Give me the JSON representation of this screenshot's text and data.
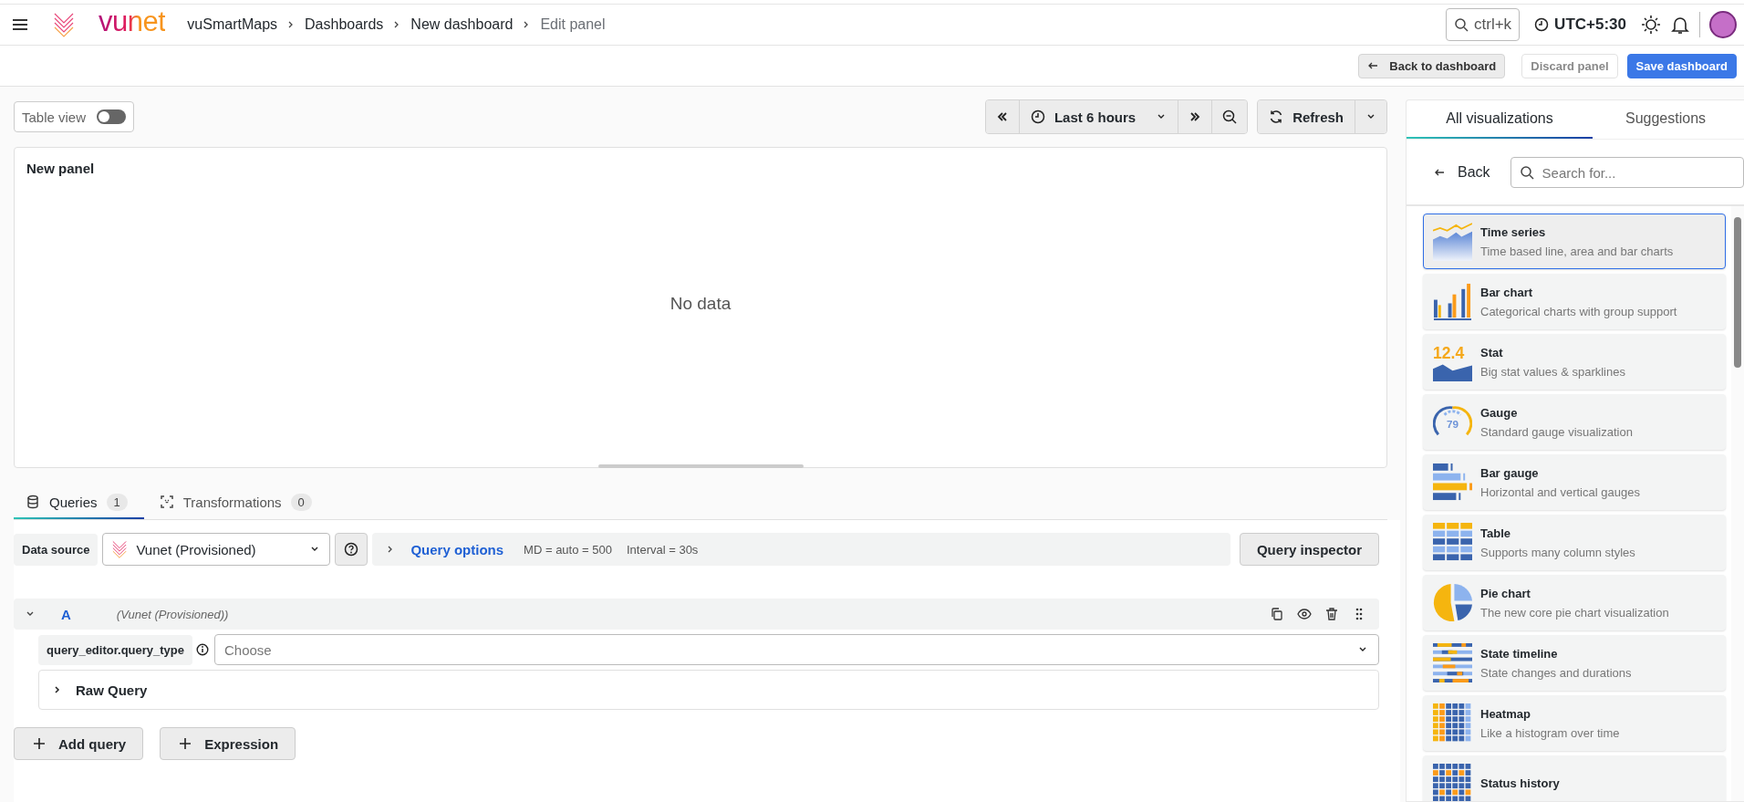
{
  "header": {
    "logo_text": "vunet",
    "breadcrumbs": [
      {
        "label": "vuSmartMaps",
        "current": false
      },
      {
        "label": "Dashboards",
        "current": false
      },
      {
        "label": "New dashboard",
        "current": false
      },
      {
        "label": "Edit panel",
        "current": true
      }
    ],
    "search_shortcut": "ctrl+k",
    "timezone": "UTC+5:30"
  },
  "actions": [
    {
      "label": "Back to dashboard",
      "kind": "back"
    },
    {
      "label": "Discard panel",
      "kind": "outline"
    },
    {
      "label": "Save dashboard",
      "kind": "primary"
    }
  ],
  "table_view": {
    "label": "Table view",
    "on": false
  },
  "time_range": {
    "label": "Last 6 hours"
  },
  "refresh": {
    "label": "Refresh"
  },
  "panel": {
    "title": "New panel",
    "message": "No data"
  },
  "query_tabs": [
    {
      "label": "Queries",
      "count": "1",
      "selected": true,
      "kind": "queries"
    },
    {
      "label": "Transformations",
      "count": "0",
      "selected": false,
      "kind": "transformations"
    }
  ],
  "data_source": {
    "label": "Data source",
    "value": "Vunet (Provisioned)",
    "options_label": "Query options",
    "md": "MD = auto = 500",
    "interval": "Interval = 30s",
    "inspector": "Query inspector"
  },
  "query": {
    "ref": "A",
    "source": "(Vunet (Provisioned))",
    "expanded": true,
    "field_label": "query_editor.query_type",
    "placeholder": "Choose",
    "raw_query": {
      "label": "Raw Query",
      "expanded": false
    }
  },
  "add_buttons": [
    {
      "label": "Add query"
    },
    {
      "label": "Expression"
    }
  ],
  "viz_panel": {
    "tabs": [
      {
        "label": "All visualizations",
        "selected": true
      },
      {
        "label": "Suggestions",
        "selected": false
      }
    ],
    "back": "Back",
    "search_placeholder": "Search for...",
    "items": [
      {
        "kind": "timeseries",
        "title": "Time series",
        "description": "Time based line, area and bar charts",
        "selected": true
      },
      {
        "kind": "barchart",
        "title": "Bar chart",
        "description": "Categorical charts with group support",
        "selected": false
      },
      {
        "kind": "stat",
        "title": "Stat",
        "description": "Big stat values & sparklines",
        "icon_text": "12.4",
        "selected": false
      },
      {
        "kind": "gauge",
        "title": "Gauge",
        "description": "Standard gauge visualization",
        "icon_text": "79",
        "selected": false
      },
      {
        "kind": "bargauge",
        "title": "Bar gauge",
        "description": "Horizontal and vertical gauges",
        "selected": false
      },
      {
        "kind": "table",
        "title": "Table",
        "description": "Supports many column styles",
        "selected": false
      },
      {
        "kind": "pie",
        "title": "Pie chart",
        "description": "The new core pie chart visualization",
        "selected": false
      },
      {
        "kind": "statetimeline",
        "title": "State timeline",
        "description": "State changes and durations",
        "selected": false
      },
      {
        "kind": "heatmap",
        "title": "Heatmap",
        "description": "Like a histogram over time",
        "selected": false
      },
      {
        "kind": "statushistory",
        "title": "Status history",
        "selected": false
      }
    ]
  }
}
